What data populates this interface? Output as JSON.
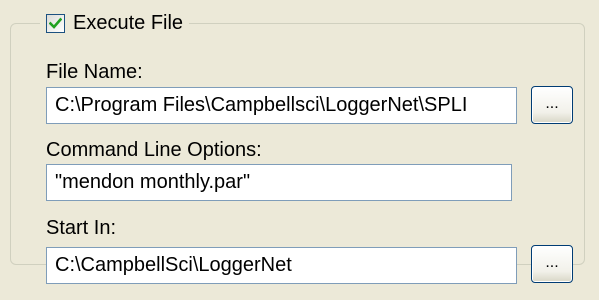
{
  "execute_file": {
    "label": "Execute File",
    "checked": true
  },
  "file_name": {
    "label": "File Name:",
    "value": "C:\\Program Files\\Campbellsci\\LoggerNet\\SPLI"
  },
  "command_line": {
    "label": "Command Line Options:",
    "value": "\"mendon monthly.par\""
  },
  "start_in": {
    "label": "Start In:",
    "value": "C:\\CampbellSci\\LoggerNet"
  },
  "browse_label": "...",
  "icons": {
    "checkmark": "checkmark-icon"
  },
  "colors": {
    "checkmark": "#21a121",
    "textbox_border": "#7f9db9",
    "button_border": "#003c74",
    "background": "#ece9d8"
  }
}
